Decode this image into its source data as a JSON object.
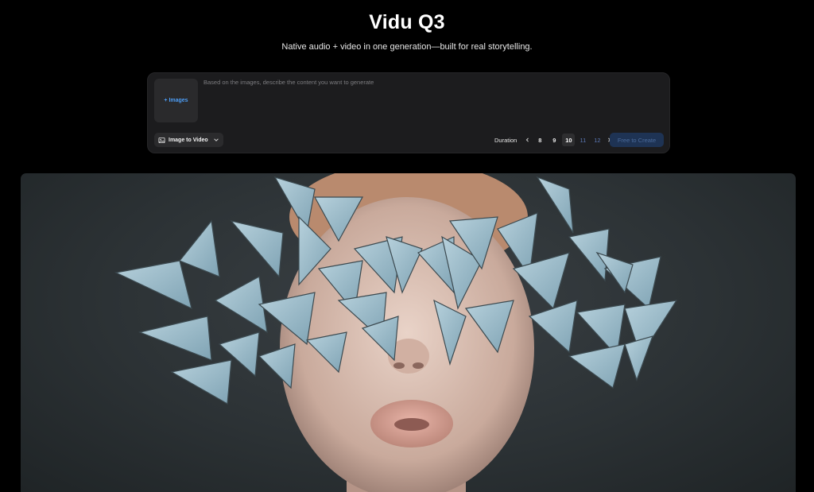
{
  "hero": {
    "title": "Vidu Q3",
    "subtitle": "Native audio + video in one generation—built for real storytelling."
  },
  "composer": {
    "upload_label": "+ Images",
    "prompt_placeholder": "Based on the images, describe the content you want to generate",
    "prompt_value": "",
    "mode": {
      "label": "Image to Video",
      "icon": "image-video-icon",
      "chevron": "chevron-down-icon"
    },
    "duration": {
      "label": "Duration",
      "options": [
        "8",
        "9",
        "10",
        "11",
        "12"
      ],
      "selected": "10",
      "disabled": [
        "11",
        "12"
      ]
    },
    "create_label": "Free to Create"
  },
  "preview": {
    "media": "video-preview",
    "description_icon": "butterfly-face-image"
  },
  "colors": {
    "accent_blue": "#4d9ef7",
    "create_bg": "#1e3354",
    "panel_bg": "#1c1c1e",
    "page_bg": "#000000"
  }
}
